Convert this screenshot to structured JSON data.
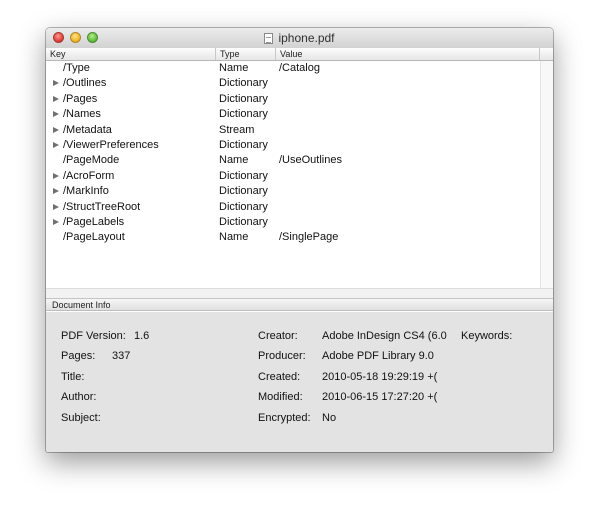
{
  "window": {
    "title": "iphone.pdf"
  },
  "columns": {
    "key": "Key",
    "type": "Type",
    "value": "Value"
  },
  "rows": [
    {
      "key": "/Type",
      "type": "Name",
      "value": "/Catalog",
      "expandable": false
    },
    {
      "key": "/Outlines",
      "type": "Dictionary",
      "value": "",
      "expandable": true
    },
    {
      "key": "/Pages",
      "type": "Dictionary",
      "value": "",
      "expandable": true
    },
    {
      "key": "/Names",
      "type": "Dictionary",
      "value": "",
      "expandable": true
    },
    {
      "key": "/Metadata",
      "type": "Stream",
      "value": "",
      "expandable": true
    },
    {
      "key": "/ViewerPreferences",
      "type": "Dictionary",
      "value": "",
      "expandable": true
    },
    {
      "key": "/PageMode",
      "type": "Name",
      "value": "/UseOutlines",
      "expandable": false
    },
    {
      "key": "/AcroForm",
      "type": "Dictionary",
      "value": "",
      "expandable": true
    },
    {
      "key": "/MarkInfo",
      "type": "Dictionary",
      "value": "",
      "expandable": true
    },
    {
      "key": "/StructTreeRoot",
      "type": "Dictionary",
      "value": "",
      "expandable": true
    },
    {
      "key": "/PageLabels",
      "type": "Dictionary",
      "value": "",
      "expandable": true
    },
    {
      "key": "/PageLayout",
      "type": "Name",
      "value": "/SinglePage",
      "expandable": false
    }
  ],
  "info": {
    "header": "Document Info",
    "pdf_version_label": "PDF Version:",
    "pdf_version": "1.6",
    "pages_label": "Pages:",
    "pages": "337",
    "title_label": "Title:",
    "author_label": "Author:",
    "subject_label": "Subject:",
    "creator_label": "Creator:",
    "creator": "Adobe InDesign CS4 (6.0",
    "producer_label": "Producer:",
    "producer": "Adobe PDF Library 9.0",
    "created_label": "Created:",
    "created": "2010-05-18 19:29:19 +(",
    "modified_label": "Modified:",
    "modified": "2010-06-15 17:27:20 +(",
    "encrypted_label": "Encrypted:",
    "encrypted": "No",
    "keywords_label": "Keywords:"
  },
  "colors": {
    "close": "#e0443c",
    "minimize": "#f0b92c",
    "zoom": "#63c042",
    "panel": "#e3e3e3"
  },
  "icons": {
    "document": "pdf-document-icon",
    "disclosure": "disclosure-triangle-icon"
  }
}
